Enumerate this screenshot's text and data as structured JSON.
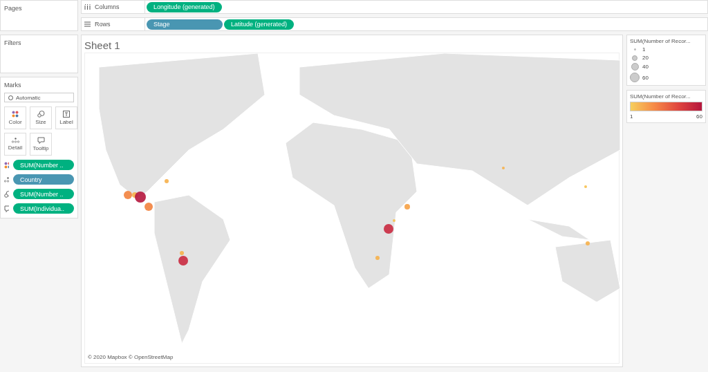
{
  "left_panels": {
    "pages": {
      "title": "Pages"
    },
    "filters": {
      "title": "Filters"
    }
  },
  "marks": {
    "title": "Marks",
    "mark_type": "Automatic",
    "cards": [
      {
        "kind": "color",
        "label": "Color"
      },
      {
        "kind": "size",
        "label": "Size"
      },
      {
        "kind": "label",
        "label": "Label"
      },
      {
        "kind": "detail",
        "label": "Detail"
      },
      {
        "kind": "tooltip",
        "label": "Tooltip"
      }
    ],
    "fields": [
      {
        "kind": "color",
        "label": "SUM(Number ..",
        "color": "#00b180"
      },
      {
        "kind": "detail",
        "label": "Country",
        "color": "#4996b2"
      },
      {
        "kind": "size",
        "label": "SUM(Number ..",
        "color": "#00b180"
      },
      {
        "kind": "tooltip",
        "label": "SUM(Individua..",
        "color": "#00b180"
      }
    ]
  },
  "shelves": [
    {
      "kind": "columns",
      "label": "Columns",
      "pills": [
        {
          "label": "Longitude (generated)",
          "color": "#00b180"
        }
      ]
    },
    {
      "kind": "rows",
      "label": "Rows",
      "pills": [
        {
          "label": "Stage",
          "color": "#4996b2"
        },
        {
          "label": "Latitude (generated)",
          "color": "#00b180"
        }
      ]
    }
  ],
  "sheet": {
    "title": "Sheet 1",
    "attribution": "© 2020 Mapbox © OpenStreetMap"
  },
  "size_legend": {
    "title": "SUM(Number of Recor...",
    "items": [
      "1",
      "20",
      "40",
      "60"
    ]
  },
  "color_legend": {
    "title": "SUM(Number of Recor...",
    "min": "1",
    "max": "60"
  }
}
